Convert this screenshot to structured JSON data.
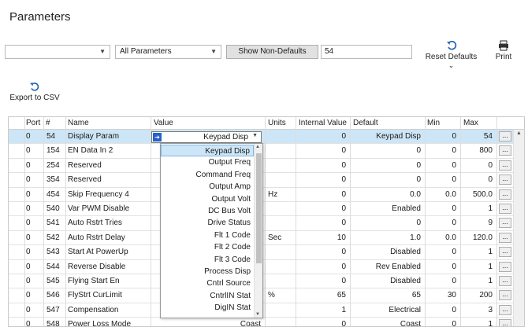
{
  "page": {
    "title": "Parameters"
  },
  "toolbar": {
    "port_combo_value": "",
    "filter_combo_value": "All Parameters",
    "show_non_defaults_label": "Show Non-Defaults",
    "search_value": "54",
    "reset_defaults_label": "Reset Defaults",
    "print_label": "Print",
    "export_csv_label": "Export to CSV"
  },
  "table": {
    "columns": [
      "Port",
      "#",
      "Name",
      "Value",
      "Units",
      "Internal Value",
      "Default",
      "Min",
      "Max"
    ],
    "rows": [
      {
        "port": "0",
        "num": "54",
        "name": "Display Param",
        "value": "Keypad Disp",
        "units": "",
        "internal": "0",
        "default": "Keypad Disp",
        "min": "0",
        "max": "54"
      },
      {
        "port": "0",
        "num": "154",
        "name": "EN Data In 2",
        "value": "",
        "units": "",
        "internal": "0",
        "default": "0",
        "min": "0",
        "max": "800"
      },
      {
        "port": "0",
        "num": "254",
        "name": "Reserved",
        "value": "",
        "units": "",
        "internal": "0",
        "default": "0",
        "min": "0",
        "max": "0"
      },
      {
        "port": "0",
        "num": "354",
        "name": "Reserved",
        "value": "",
        "units": "",
        "internal": "0",
        "default": "0",
        "min": "0",
        "max": "0"
      },
      {
        "port": "0",
        "num": "454",
        "name": "Skip Frequency 4",
        "value": "",
        "units": "Hz",
        "internal": "0",
        "default": "0.0",
        "min": "0.0",
        "max": "500.0"
      },
      {
        "port": "0",
        "num": "540",
        "name": "Var PWM Disable",
        "value": "",
        "units": "",
        "internal": "0",
        "default": "Enabled",
        "min": "0",
        "max": "1"
      },
      {
        "port": "0",
        "num": "541",
        "name": "Auto Rstrt Tries",
        "value": "",
        "units": "",
        "internal": "0",
        "default": "0",
        "min": "0",
        "max": "9"
      },
      {
        "port": "0",
        "num": "542",
        "name": "Auto Rstrt Delay",
        "value": "",
        "units": "Sec",
        "internal": "10",
        "default": "1.0",
        "min": "0.0",
        "max": "120.0"
      },
      {
        "port": "0",
        "num": "543",
        "name": "Start At PowerUp",
        "value": "",
        "units": "",
        "internal": "0",
        "default": "Disabled",
        "min": "0",
        "max": "1"
      },
      {
        "port": "0",
        "num": "544",
        "name": "Reverse Disable",
        "value": "",
        "units": "",
        "internal": "0",
        "default": "Rev Enabled",
        "min": "0",
        "max": "1"
      },
      {
        "port": "0",
        "num": "545",
        "name": "Flying Start En",
        "value": "",
        "units": "",
        "internal": "0",
        "default": "Disabled",
        "min": "0",
        "max": "1"
      },
      {
        "port": "0",
        "num": "546",
        "name": "FlyStrt CurLimit",
        "value": "",
        "units": "%",
        "internal": "65",
        "default": "65",
        "min": "30",
        "max": "200"
      },
      {
        "port": "0",
        "num": "547",
        "name": "Compensation",
        "value": "",
        "units": "",
        "internal": "1",
        "default": "Electrical",
        "min": "0",
        "max": "3"
      },
      {
        "port": "0",
        "num": "548",
        "name": "Power Loss Mode",
        "value": "Coast",
        "units": "",
        "internal": "0",
        "default": "Coast",
        "min": "0",
        "max": "1"
      }
    ],
    "ellipsis_label": "..."
  },
  "editor": {
    "current_value": "Keypad Disp",
    "options": [
      "Keypad Disp",
      "Output Freq",
      "Command Freq",
      "Output Amp",
      "Output Volt",
      "DC Bus Volt",
      "Drive Status",
      "Flt 1 Code",
      "Flt 2 Code",
      "Flt 3 Code",
      "Process Disp",
      "Cntrl Source",
      "CntrlIN Stat",
      "DigIN Stat"
    ],
    "highlighted_index": 0
  },
  "colors": {
    "selection": "#cde6f7",
    "accent": "#2462c8"
  }
}
